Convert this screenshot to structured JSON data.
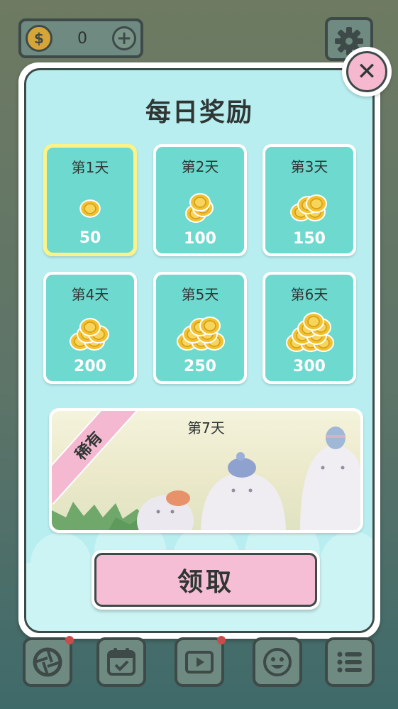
{
  "hud": {
    "coin_symbol": "$",
    "coin_count": "0",
    "plus_label": "+"
  },
  "dialog": {
    "title": "每日奖励",
    "close_label": "✕",
    "days": [
      {
        "label": "第1天",
        "amount": "50",
        "active": true,
        "coin_stack": 1
      },
      {
        "label": "第2天",
        "amount": "100",
        "active": false,
        "coin_stack": 2
      },
      {
        "label": "第3天",
        "amount": "150",
        "active": false,
        "coin_stack": 3
      },
      {
        "label": "第4天",
        "amount": "200",
        "active": false,
        "coin_stack": 4
      },
      {
        "label": "第5天",
        "amount": "250",
        "active": false,
        "coin_stack": 5
      },
      {
        "label": "第6天",
        "amount": "300",
        "active": false,
        "coin_stack": 6
      }
    ],
    "rare_day": {
      "label": "第7天",
      "ribbon": "稀有"
    },
    "claim_label": "领取"
  },
  "nav": [
    {
      "icon": "aperture-icon",
      "badge": true
    },
    {
      "icon": "calendar-check-icon",
      "badge": false
    },
    {
      "icon": "video-play-icon",
      "badge": true
    },
    {
      "icon": "smiley-icon",
      "badge": false
    },
    {
      "icon": "list-icon",
      "badge": false
    }
  ],
  "colors": {
    "card_teal": "#6ed9cf",
    "panel_bg": "#b8eef0",
    "active_highlight": "#fbf38a",
    "button_pink": "#f5bed4",
    "coin_gold": "#f3c12e"
  }
}
